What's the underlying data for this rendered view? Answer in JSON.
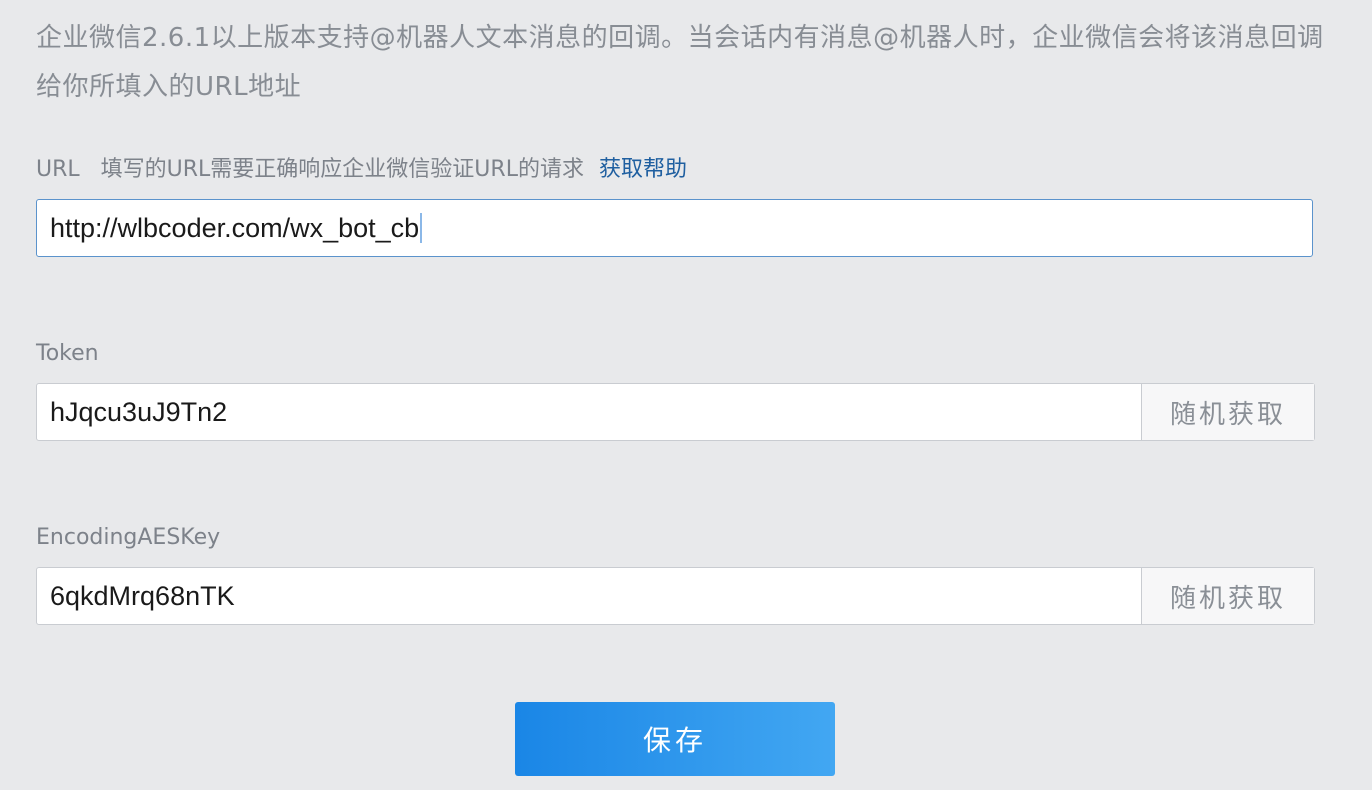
{
  "description": "企业微信2.6.1以上版本支持@机器人文本消息的回调。当会话内有消息@机器人时，企业微信会将该消息回调给你所填入的URL地址",
  "url_field": {
    "label": "URL",
    "hint": "填写的URL需要正确响应企业微信验证URL的请求",
    "help_link": "获取帮助",
    "value": "http://wlbcoder.com/wx_bot_cb"
  },
  "token_field": {
    "label": "Token",
    "value": "hJqcu3uJ9Tn2",
    "random_button": "随机获取"
  },
  "aes_field": {
    "label": "EncodingAESKey",
    "value": "6qkdMrq68nTK",
    "random_button": "随机获取"
  },
  "save_button": "保存",
  "colors": {
    "background": "#e8e9eb",
    "link": "#1f5fa0",
    "focus_border": "#5b93cc",
    "button_gradient_start": "#1a86e6",
    "button_gradient_end": "#42a7f2"
  }
}
